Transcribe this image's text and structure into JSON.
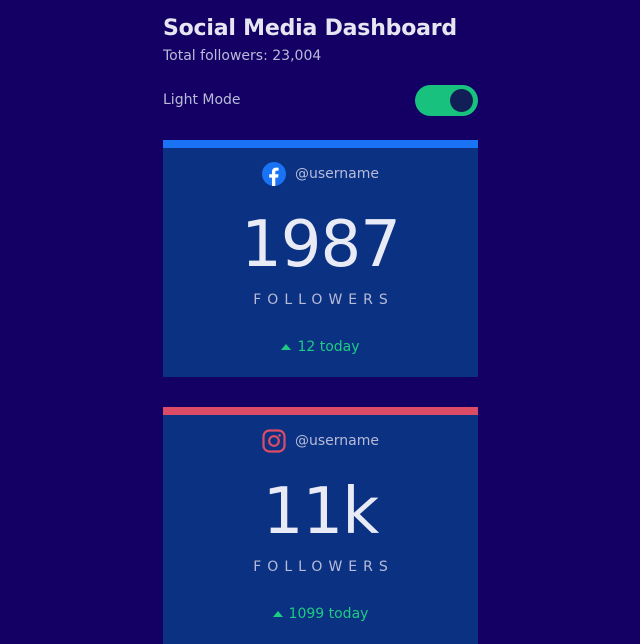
{
  "header": {
    "title": "Social Media Dashboard",
    "total_followers": "Total followers: 23,004",
    "mode_label": "Light Mode"
  },
  "colors": {
    "background": "#140064",
    "card": "#0a3182",
    "toggle": "#18c27e",
    "facebook": "#1a73f4",
    "instagram": "#dc4c67",
    "positive": "#1ccc82"
  },
  "cards": [
    {
      "network": "facebook",
      "icon": "facebook-icon",
      "handle": "@username",
      "count": "1987",
      "label": "FOLLOWERS",
      "today": "12 today"
    },
    {
      "network": "instagram",
      "icon": "instagram-icon",
      "handle": "@username",
      "count": "11k",
      "label": "FOLLOWERS",
      "today": "1099 today"
    }
  ]
}
